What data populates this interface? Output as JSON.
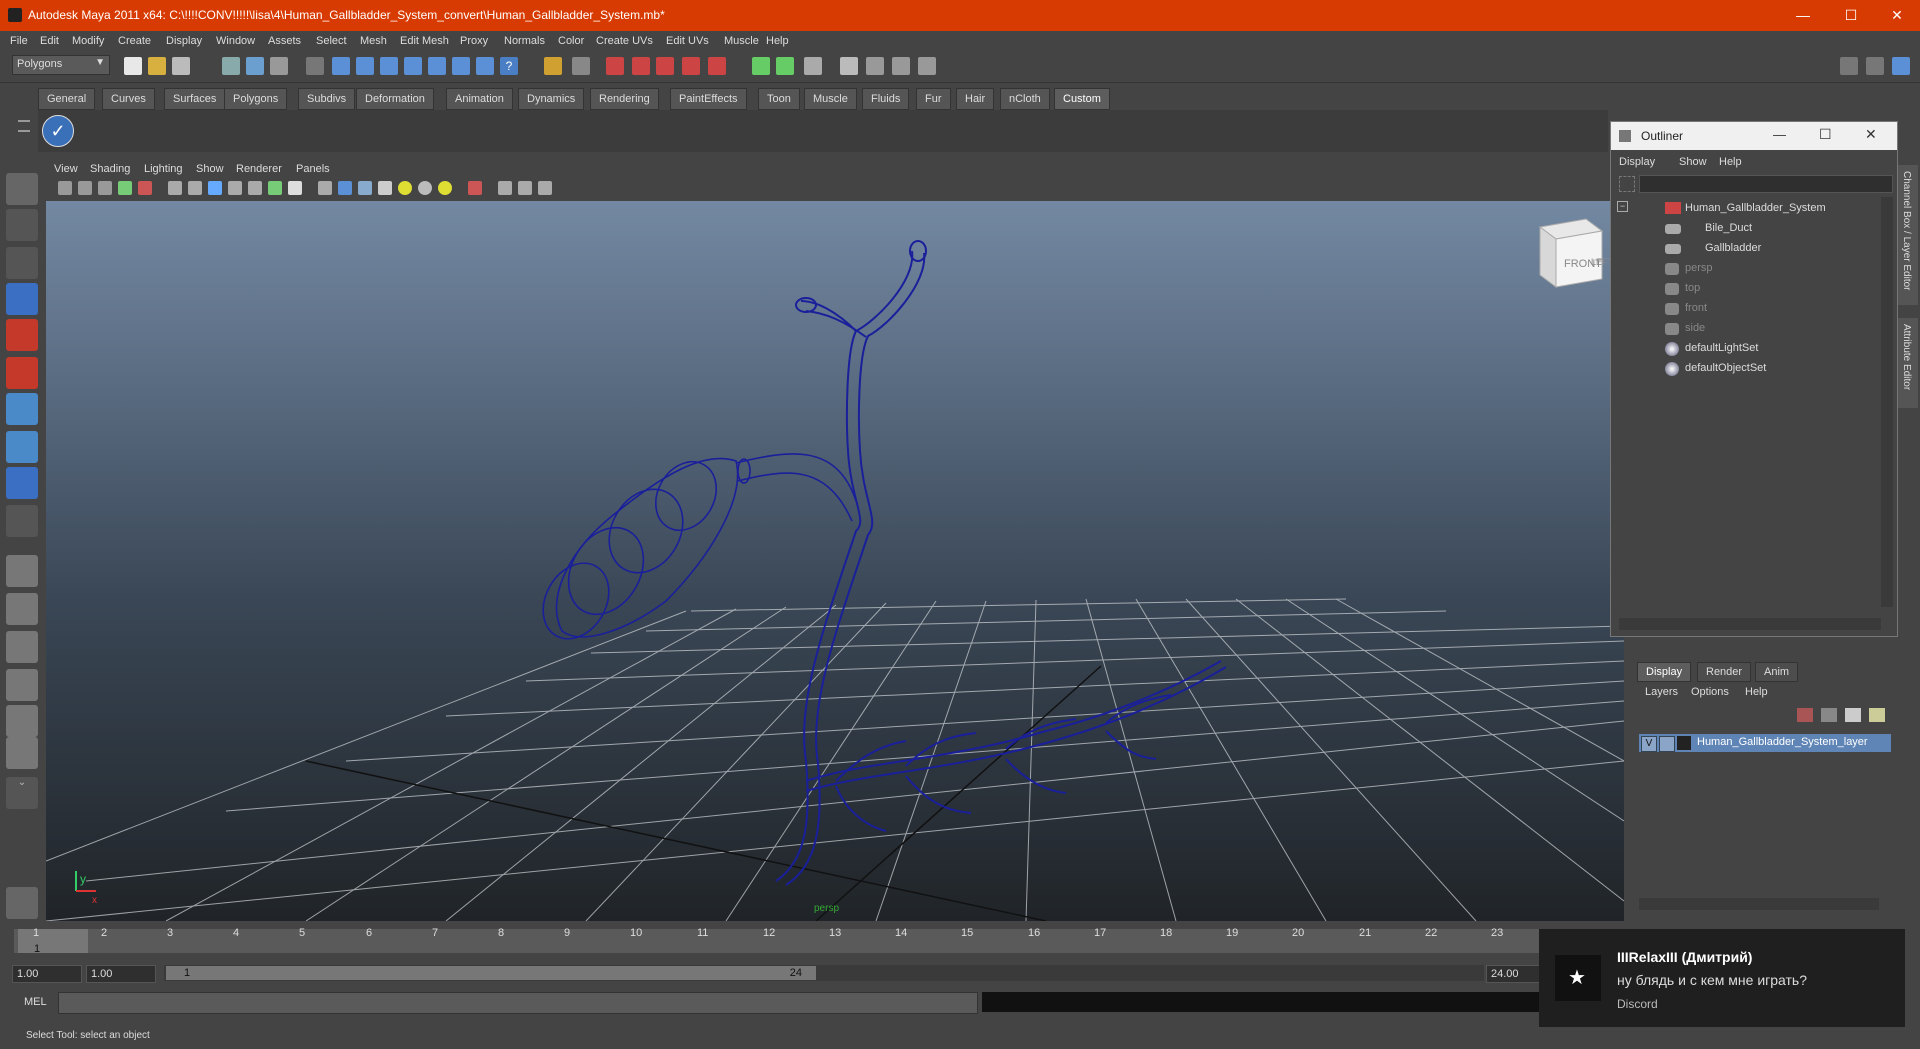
{
  "window": {
    "title": "Autodesk Maya 2011 x64: C:\\!!!!CONV!!!!!\\lisa\\4\\Human_Gallbladder_System_convert\\Human_Gallbladder_System.mb*",
    "minimize_icon": "minimize-icon",
    "maximize_icon": "maximize-icon",
    "close_icon": "close-icon"
  },
  "menubar": [
    "File",
    "Edit",
    "Modify",
    "Create",
    "Display",
    "Window",
    "Assets",
    "Select",
    "Mesh",
    "Edit Mesh",
    "Proxy",
    "Normals",
    "Color",
    "Create UVs",
    "Edit UVs",
    "Muscle",
    "Help"
  ],
  "statusline": {
    "mode_selector": "Polygons"
  },
  "shelf": {
    "tabs": [
      "General",
      "Curves",
      "Surfaces",
      "Polygons",
      "Subdivs",
      "Deformation",
      "Animation",
      "Dynamics",
      "Rendering",
      "PaintEffects",
      "Toon",
      "Muscle",
      "Fluids",
      "Fur",
      "Hair",
      "nCloth",
      "Custom"
    ],
    "active_tab": "Custom"
  },
  "panel_menu": [
    "View",
    "Shading",
    "Lighting",
    "Show",
    "Renderer",
    "Panels"
  ],
  "viewport": {
    "camera_label": "persp",
    "viewcube_front": "FRONT",
    "viewcube_side": "LEFT",
    "axis_y": "y",
    "axis_x": "x",
    "wire_color": "#1a1f9a"
  },
  "outliner": {
    "title": "Outliner",
    "menu": [
      "Display",
      "Show",
      "Help"
    ],
    "items": [
      {
        "label": "Human_Gallbladder_System",
        "dim": false,
        "indent": 0
      },
      {
        "label": "Bile_Duct",
        "dim": false,
        "indent": 1
      },
      {
        "label": "Gallbladder",
        "dim": false,
        "indent": 1
      },
      {
        "label": "persp",
        "dim": true,
        "indent": 0
      },
      {
        "label": "top",
        "dim": true,
        "indent": 0
      },
      {
        "label": "front",
        "dim": true,
        "indent": 0
      },
      {
        "label": "side",
        "dim": true,
        "indent": 0
      },
      {
        "label": "defaultLightSet",
        "dim": false,
        "indent": 0
      },
      {
        "label": "defaultObjectSet",
        "dim": false,
        "indent": 0
      }
    ]
  },
  "side_tabs": {
    "channel_box": "Channel Box / Layer Editor",
    "attribute_editor": "Attribute Editor"
  },
  "layer_editor": {
    "tabs": [
      "Display",
      "Render",
      "Anim"
    ],
    "active_tab": "Display",
    "menu": [
      "Layers",
      "Options",
      "Help"
    ],
    "layer": {
      "visible": "V",
      "name": "Human_Gallbladder_System_layer"
    }
  },
  "timeline": {
    "ticks": [
      "1",
      "2",
      "3",
      "4",
      "5",
      "6",
      "7",
      "8",
      "9",
      "10",
      "11",
      "12",
      "13",
      "14",
      "15",
      "16",
      "17",
      "18",
      "19",
      "20",
      "21",
      "22",
      "23"
    ],
    "current_frame": "1"
  },
  "range": {
    "start_time": "1.00",
    "playback_start": "1.00",
    "range_start_label": "1",
    "range_end_label": "24",
    "end_time": "24.00"
  },
  "command_line": {
    "label": "MEL"
  },
  "help_line": "Select Tool: select an object",
  "notification": {
    "title": "IIIRelaxIII (Дмитрий)",
    "message": "ну блядь и с кем мне играть?",
    "app": "Discord"
  }
}
